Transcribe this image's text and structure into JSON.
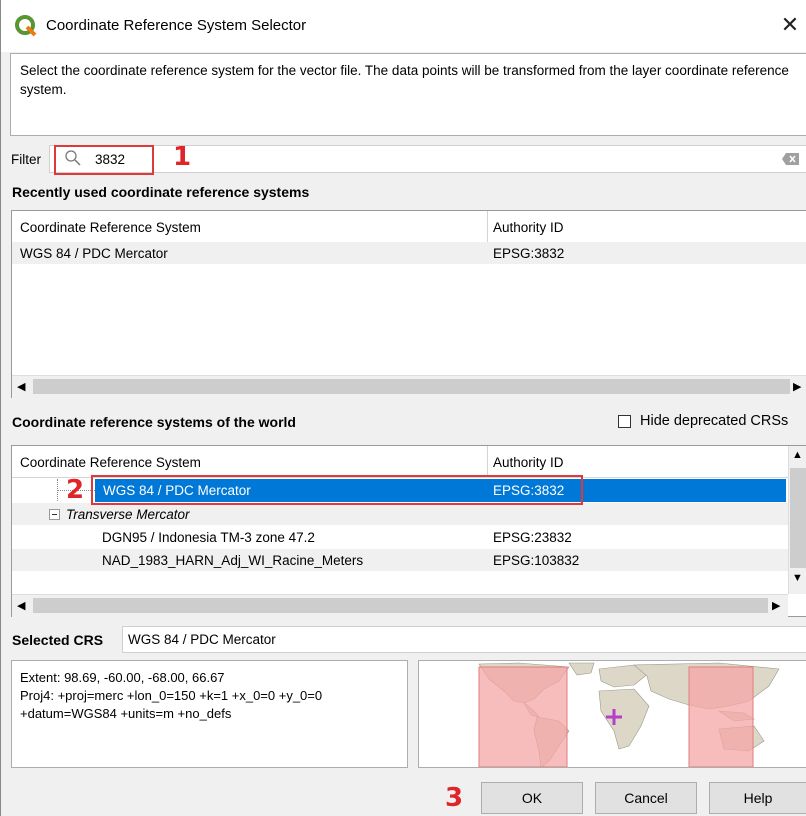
{
  "window": {
    "title": "Coordinate Reference System Selector",
    "close_glyph": "✕"
  },
  "description": "Select the coordinate reference system for the vector file. The data points will be transformed from the layer coordinate reference system.",
  "filter": {
    "label": "Filter",
    "value": "3832"
  },
  "recent": {
    "title": "Recently used coordinate reference systems",
    "columns": [
      "Coordinate Reference System",
      "Authority ID"
    ],
    "rows": [
      {
        "name": "WGS 84 / PDC Mercator",
        "auth": "EPSG:3832"
      }
    ]
  },
  "world": {
    "title": "Coordinate reference systems of the world",
    "hide_deprecated_label": "Hide deprecated CRSs",
    "hide_deprecated_checked": false,
    "columns": [
      "Coordinate Reference System",
      "Authority ID"
    ],
    "rows": [
      {
        "name": "WGS 84 / PDC Mercator",
        "auth": "EPSG:3832",
        "selected": true
      },
      {
        "name": "Transverse Mercator",
        "auth": "",
        "group": true
      },
      {
        "name": "DGN95 / Indonesia TM-3 zone 47.2",
        "auth": "EPSG:23832"
      },
      {
        "name": "NAD_1983_HARN_Adj_WI_Racine_Meters",
        "auth": "EPSG:103832"
      }
    ]
  },
  "selected_crs": {
    "label": "Selected CRS",
    "value": "WGS 84 / PDC Mercator"
  },
  "info": {
    "extent": "Extent: 98.69, -60.00, -68.00, 66.67",
    "proj4_line1": "Proj4: +proj=merc +lon_0=150 +k=1 +x_0=0 +y_0=0",
    "proj4_line2": "+datum=WGS84 +units=m +no_defs"
  },
  "buttons": {
    "ok": "OK",
    "cancel": "Cancel",
    "help": "Help"
  },
  "annotations": {
    "m1": "1",
    "m2": "2",
    "m3": "3"
  },
  "colors": {
    "selection": "#0078d7",
    "annotation_red": "#e0393b",
    "extent_fill": "#f4a5a5"
  }
}
